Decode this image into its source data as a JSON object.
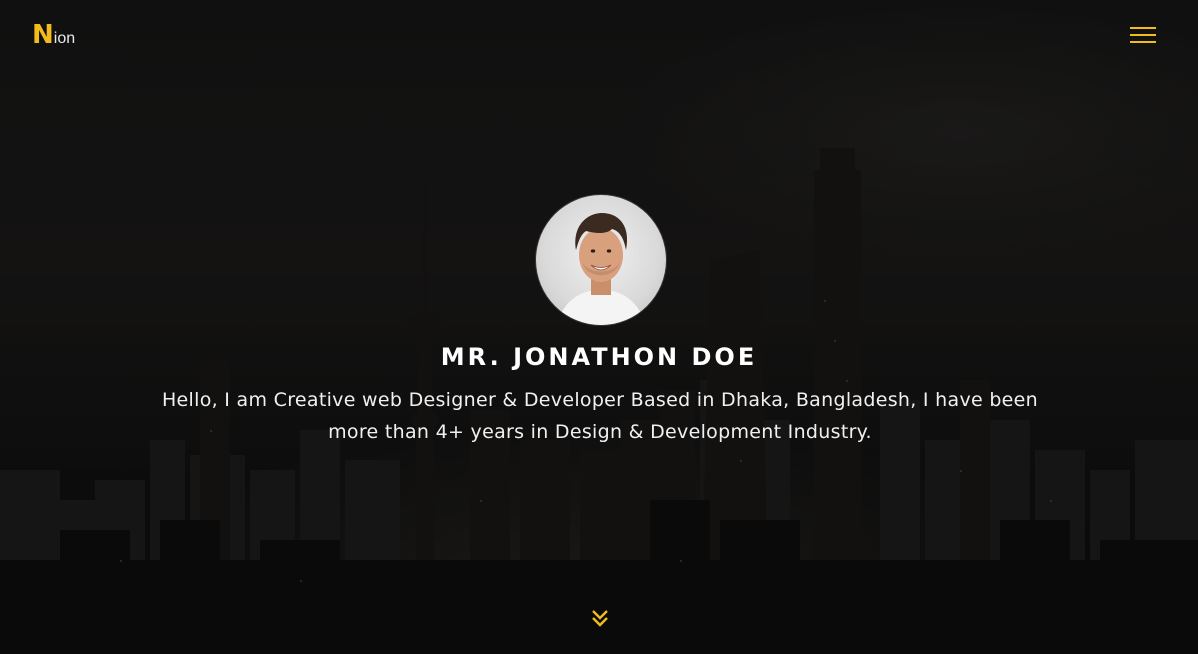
{
  "header": {
    "logo_letter": "N",
    "logo_rest": "ion",
    "menu_icon": "hamburger-menu-icon"
  },
  "hero": {
    "avatar_alt": "Portrait of Mr. Jonathon Doe",
    "name": "MR. JONATHON DOE",
    "bio": "Hello, I am Creative web Designer & Developer Based in Dhaka, Bangladesh, I have been more than 4+ years in Design & Development Industry.",
    "scroll_icon": "double-chevron-down-icon"
  },
  "colors": {
    "accent": "#f2bc1b",
    "text": "#ffffff",
    "background": "#121212"
  }
}
